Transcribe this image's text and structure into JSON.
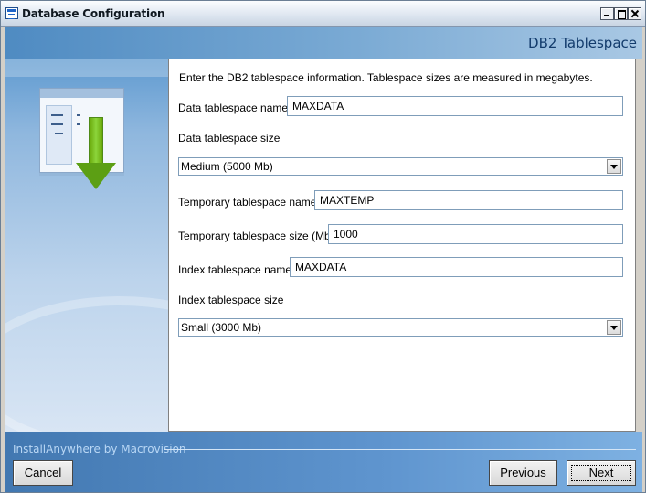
{
  "window": {
    "title": "Database Configuration",
    "controls": {
      "minimize": "minimize-icon",
      "maximize": "maximize-icon",
      "close": "close-icon"
    }
  },
  "header": {
    "title": "DB2 Tablespace"
  },
  "content": {
    "intro": "Enter the DB2 tablespace information. Tablespace sizes are measured in megabytes.",
    "fields": {
      "data_name_label": "Data tablespace name",
      "data_name_value": "MAXDATA",
      "data_size_label": "Data tablespace size",
      "data_size_value": "Medium (5000 Mb)",
      "temp_name_label": "Temporary tablespace name",
      "temp_name_value": "MAXTEMP",
      "temp_size_label": "Temporary tablespace size (Mb)",
      "temp_size_value": "1000",
      "index_name_label": "Index tablespace name",
      "index_name_value": "MAXDATA",
      "index_size_label": "Index tablespace size",
      "index_size_value": "Small (3000 Mb)"
    }
  },
  "footer": {
    "brand": "InstallAnywhere by Macrovision",
    "buttons": {
      "cancel": "Cancel",
      "previous": "Previous",
      "next": "Next"
    }
  },
  "colors": {
    "header_blue": "#4f8bc2",
    "footer_blue": "#4278b1",
    "arrow_green": "#6ab51f"
  },
  "icons": {
    "app": "database-config-icon",
    "graphic": "download-arrow-icon"
  }
}
